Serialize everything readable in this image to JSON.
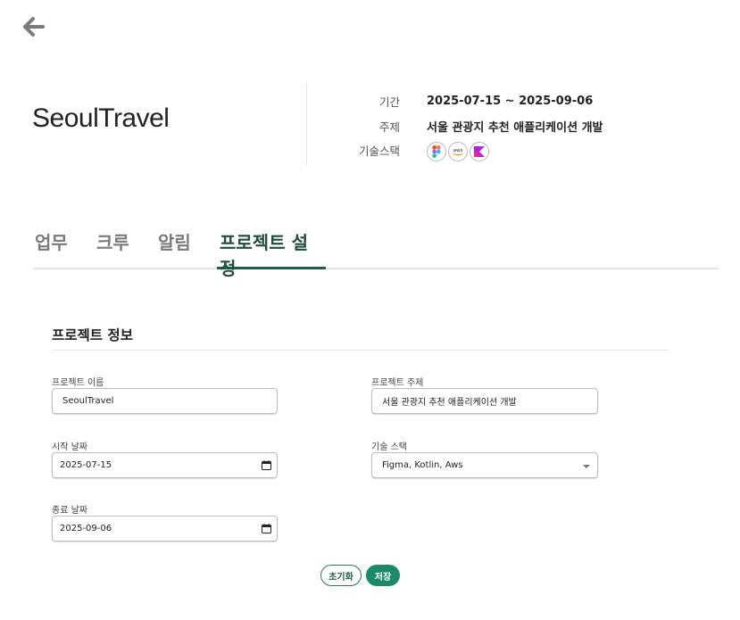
{
  "header": {
    "project_name": "SeoulTravel",
    "meta": {
      "period_label": "기간",
      "period_value": "2025-07-15 ~ 2025-09-06",
      "topic_label": "주제",
      "topic_value": "서울 관광지 추천 애플리케이션 개발",
      "stack_label": "기술스택",
      "stack_icons": [
        "figma-icon",
        "aws-icon",
        "kotlin-icon"
      ]
    }
  },
  "tabs": [
    {
      "label": "업무",
      "active": false
    },
    {
      "label": "크루",
      "active": false
    },
    {
      "label": "알림",
      "active": false
    },
    {
      "label": "프로젝트 설정",
      "active": true
    }
  ],
  "settings": {
    "section_title": "프로젝트 정보",
    "name_label": "프로젝트 이름",
    "name_value": "SeoulTravel",
    "topic_label": "프로젝트 주제",
    "topic_value": "서울 관광지 추천 애플리케이션 개발",
    "start_label": "시작 날짜",
    "start_value": "2025-07-15",
    "stack_label": "기술 스택",
    "stack_value": "Figma, Kotlin, Aws",
    "end_label": "종료 날짜",
    "end_value": "2025-09-06"
  },
  "actions": {
    "reset_label": "초기화",
    "save_label": "저장"
  },
  "colors": {
    "accent": "#1a8a68",
    "tab_active": "#1f4d3f"
  }
}
